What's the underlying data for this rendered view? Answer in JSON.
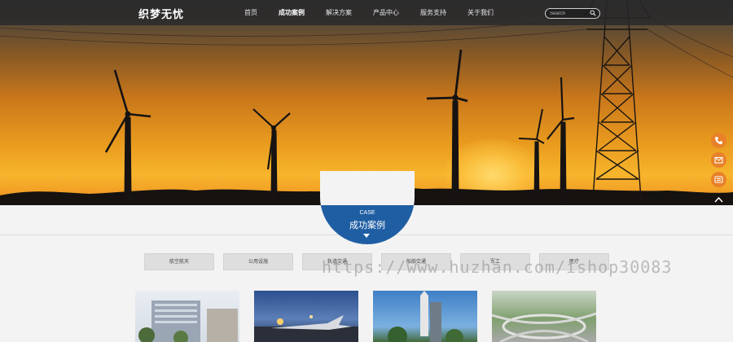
{
  "brand": {
    "logo_text": "织梦无忧"
  },
  "nav": {
    "items": [
      "首页",
      "成功案例",
      "解决方案",
      "产品中心",
      "服务支持",
      "关于我们"
    ],
    "active_index": 1
  },
  "search": {
    "placeholder": "Search"
  },
  "section": {
    "badge_en": "CASE",
    "badge_cn": "成功案例"
  },
  "categories": [
    "航空航天",
    "公用设施",
    "轨道交通",
    "船舶交通",
    "军工",
    "医疗"
  ],
  "watermark": "https://www.huzhan.com/ishop30083",
  "colors": {
    "accent_blue": "#1f5ea3",
    "side_orange": "#e8812a",
    "nav_bg": "#28282a"
  },
  "side_buttons": [
    "phone-icon",
    "mail-icon",
    "wechat-icon",
    "back-to-top-icon"
  ],
  "thumbnails": [
    "office-building",
    "airport-aircraft",
    "rocket-launch-tower",
    "highway-interchange"
  ]
}
